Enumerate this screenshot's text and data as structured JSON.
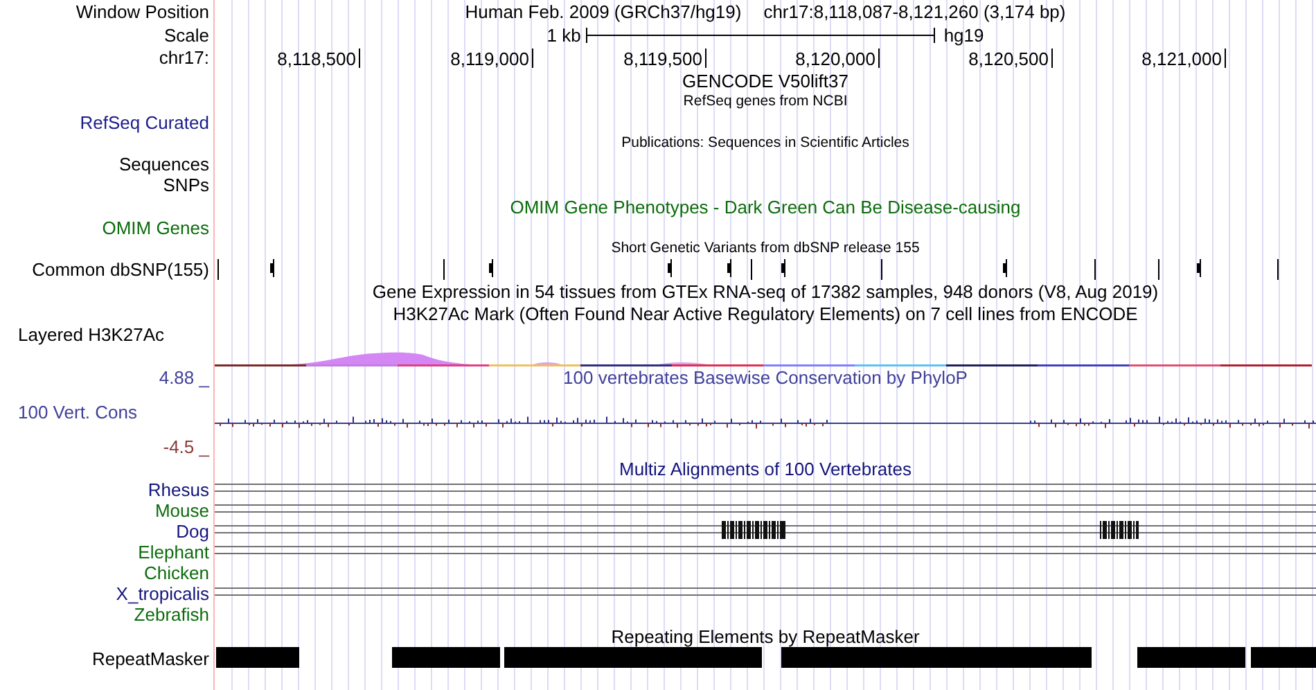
{
  "header": {
    "label": "Window Position",
    "assembly": "Human Feb. 2009 (GRCh37/hg19)",
    "position": "chr17:8,118,087-8,121,260 (3,174 bp)"
  },
  "scale": {
    "label": "Scale",
    "length": "1 kb",
    "assembly": "hg19"
  },
  "ruler": {
    "label": "chr17:",
    "ticks": [
      "8,118,500",
      "8,119,000",
      "8,119,500",
      "8,120,000",
      "8,120,500",
      "8,121,000"
    ]
  },
  "rows": [
    {
      "kind": "title",
      "text": "GENCODE V50lift37",
      "color": "#000000"
    },
    {
      "kind": "note",
      "text": "RefSeq genes from NCBI"
    },
    {
      "kind": "track",
      "label": "RefSeq Curated",
      "color": "#1c1c8c"
    },
    {
      "kind": "note",
      "text": "Publications: Sequences in Scientific Articles"
    },
    {
      "kind": "track",
      "label": "Sequences",
      "color": "#000000"
    },
    {
      "kind": "track",
      "label": "SNPs",
      "color": "#000000"
    },
    {
      "kind": "title",
      "text": "OMIM Gene Phenotypes - Dark Green Can Be Disease-causing",
      "color": "#0c6c0c"
    },
    {
      "kind": "track",
      "label": "OMIM Genes",
      "color": "#0c6c0c"
    },
    {
      "kind": "note",
      "text": "Short Genetic Variants from dbSNP release 155"
    },
    {
      "kind": "variants",
      "label": "Common dbSNP(155)",
      "color": "#000000"
    },
    {
      "kind": "title",
      "text": "Gene Expression in 54 tissues from GTEx RNA-seq of 17382 samples, 948 donors (V8, Aug 2019)",
      "color": "#000000"
    },
    {
      "kind": "title",
      "text": "H3K27Ac Mark (Often Found Near Active Regulatory Elements) on 7 cell lines from ENCODE",
      "color": "#000000"
    },
    {
      "kind": "signal",
      "label": "Layered H3K27Ac",
      "color": "#000000"
    },
    {
      "kind": "conservation",
      "label": "100 Vert. Cons",
      "color": "#40409a",
      "title": "100 vertebrates Basewise Conservation by PhyloP",
      "max": "4.88 _",
      "min": "-4.5 _"
    },
    {
      "kind": "title",
      "text": "Multiz Alignments of 100 Vertebrates",
      "color": "#14147c"
    },
    {
      "kind": "alignments",
      "species": [
        {
          "name": "Rhesus",
          "color": "#14147c",
          "kind": "lines"
        },
        {
          "name": "Mouse",
          "color": "#0c6c0c",
          "kind": "lines"
        },
        {
          "name": "Dog",
          "color": "#14147c",
          "kind": "blocks"
        },
        {
          "name": "Elephant",
          "color": "#0c6c0c",
          "kind": "lines"
        },
        {
          "name": "Chicken",
          "color": "#0c6c0c",
          "kind": "none"
        },
        {
          "name": "X_tropicalis",
          "color": "#14147c",
          "kind": "lines"
        },
        {
          "name": "Zebrafish",
          "color": "#0c6c0c",
          "kind": "none"
        }
      ]
    },
    {
      "kind": "title",
      "text": "Repeating Elements by RepeatMasker",
      "color": "#000000"
    },
    {
      "kind": "repeats",
      "label": "RepeatMasker",
      "color": "#000000"
    }
  ]
}
